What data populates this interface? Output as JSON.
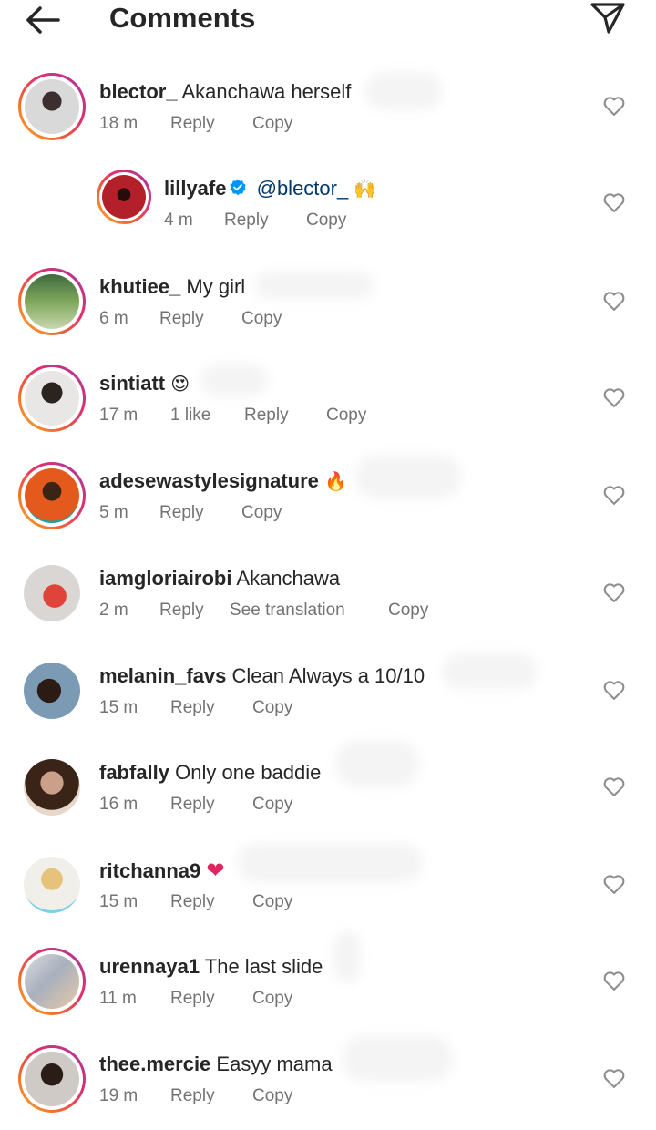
{
  "header": {
    "title": "Comments",
    "back_icon": "arrow-left-icon",
    "share_icon": "paper-plane-icon"
  },
  "colors": {
    "text": "#262626",
    "muted": "#737373",
    "mention": "#00376b",
    "verified": "#0095f6",
    "heart_red": "#e0245e"
  },
  "comments": [
    {
      "username": "blector_",
      "text": "Akanchawa herself",
      "time": "18 m",
      "reply": "Reply",
      "copy": "Copy",
      "story_ring": true
    },
    {
      "username": "lillyafe",
      "verified": true,
      "mention": "@blector_",
      "emoji": "🙌",
      "time": "4 m",
      "reply": "Reply",
      "copy": "Copy",
      "story_ring": true,
      "is_reply": true
    },
    {
      "username": "khutiee_",
      "text": "My girl",
      "time": "6 m",
      "reply": "Reply",
      "copy": "Copy",
      "story_ring": true
    },
    {
      "username": "sintiatt",
      "emoji": "😍",
      "time": "17 m",
      "likes": "1 like",
      "reply": "Reply",
      "copy": "Copy",
      "story_ring": true
    },
    {
      "username": "adesewastylesignature",
      "emoji": "🔥",
      "time": "5 m",
      "reply": "Reply",
      "copy": "Copy",
      "story_ring": true
    },
    {
      "username": "iamgloriairobi",
      "text": "Akanchawa",
      "time": "2 m",
      "reply": "Reply",
      "translate": "See translation",
      "copy": "Copy",
      "story_ring": false
    },
    {
      "username": "melanin_favs",
      "text": "Clean Always a 10/10",
      "time": "15 m",
      "reply": "Reply",
      "copy": "Copy",
      "story_ring": false
    },
    {
      "username": "fabfally",
      "text": "Only one baddie",
      "time": "16 m",
      "reply": "Reply",
      "copy": "Copy",
      "story_ring": false
    },
    {
      "username": "ritchanna9",
      "emoji": "❤",
      "time": "15 m",
      "reply": "Reply",
      "copy": "Copy",
      "story_ring": false
    },
    {
      "username": "urennaya1",
      "text": "The last slide",
      "time": "11 m",
      "reply": "Reply",
      "copy": "Copy",
      "story_ring": true
    },
    {
      "username": "thee.mercie",
      "text": "Easyy mama",
      "time": "19 m",
      "reply": "Reply",
      "copy": "Copy",
      "story_ring": true
    }
  ]
}
